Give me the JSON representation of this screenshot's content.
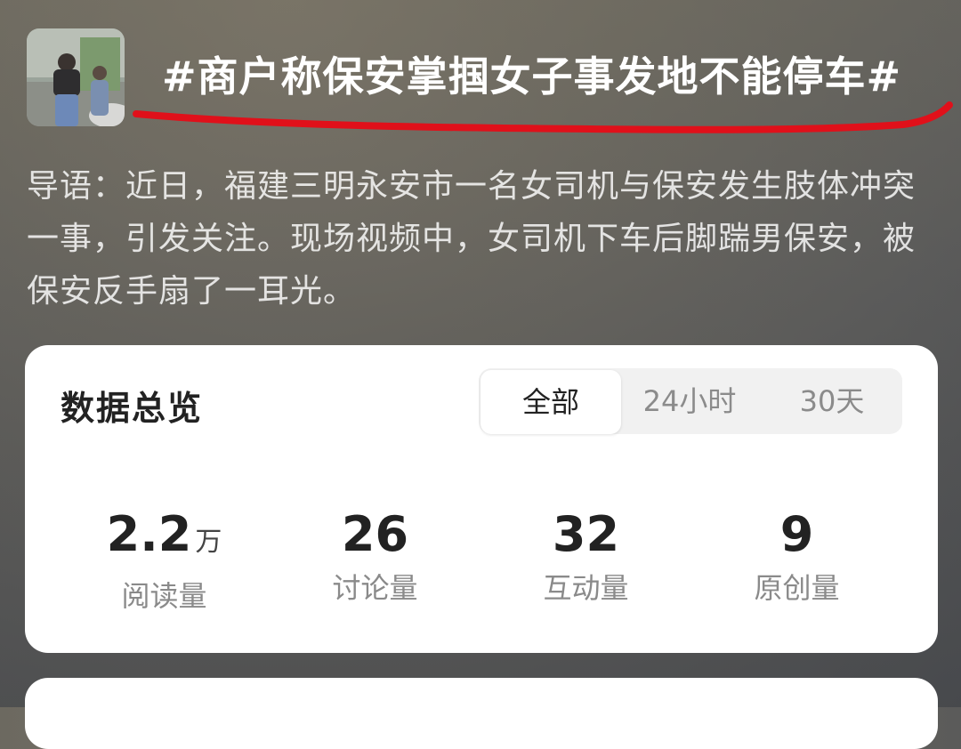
{
  "topic": {
    "title": "#商户称保安掌掴女子事发地不能停车#",
    "intro": "导语：近日，福建三明永安市一名女司机与保安发生肢体冲突一事，引发关注。现场视频中，女司机下车后脚踹男保安，被保安反手扇了一耳光。",
    "underline_color": "#e0101a"
  },
  "overview": {
    "title": "数据总览",
    "tabs": [
      {
        "label": "全部",
        "active": true
      },
      {
        "label": "24小时",
        "active": false
      },
      {
        "label": "30天",
        "active": false
      }
    ],
    "stats": [
      {
        "value": "2.2",
        "unit": "万",
        "label": "阅读量"
      },
      {
        "value": "26",
        "unit": "",
        "label": "讨论量"
      },
      {
        "value": "32",
        "unit": "",
        "label": "互动量"
      },
      {
        "value": "9",
        "unit": "",
        "label": "原创量"
      }
    ]
  }
}
